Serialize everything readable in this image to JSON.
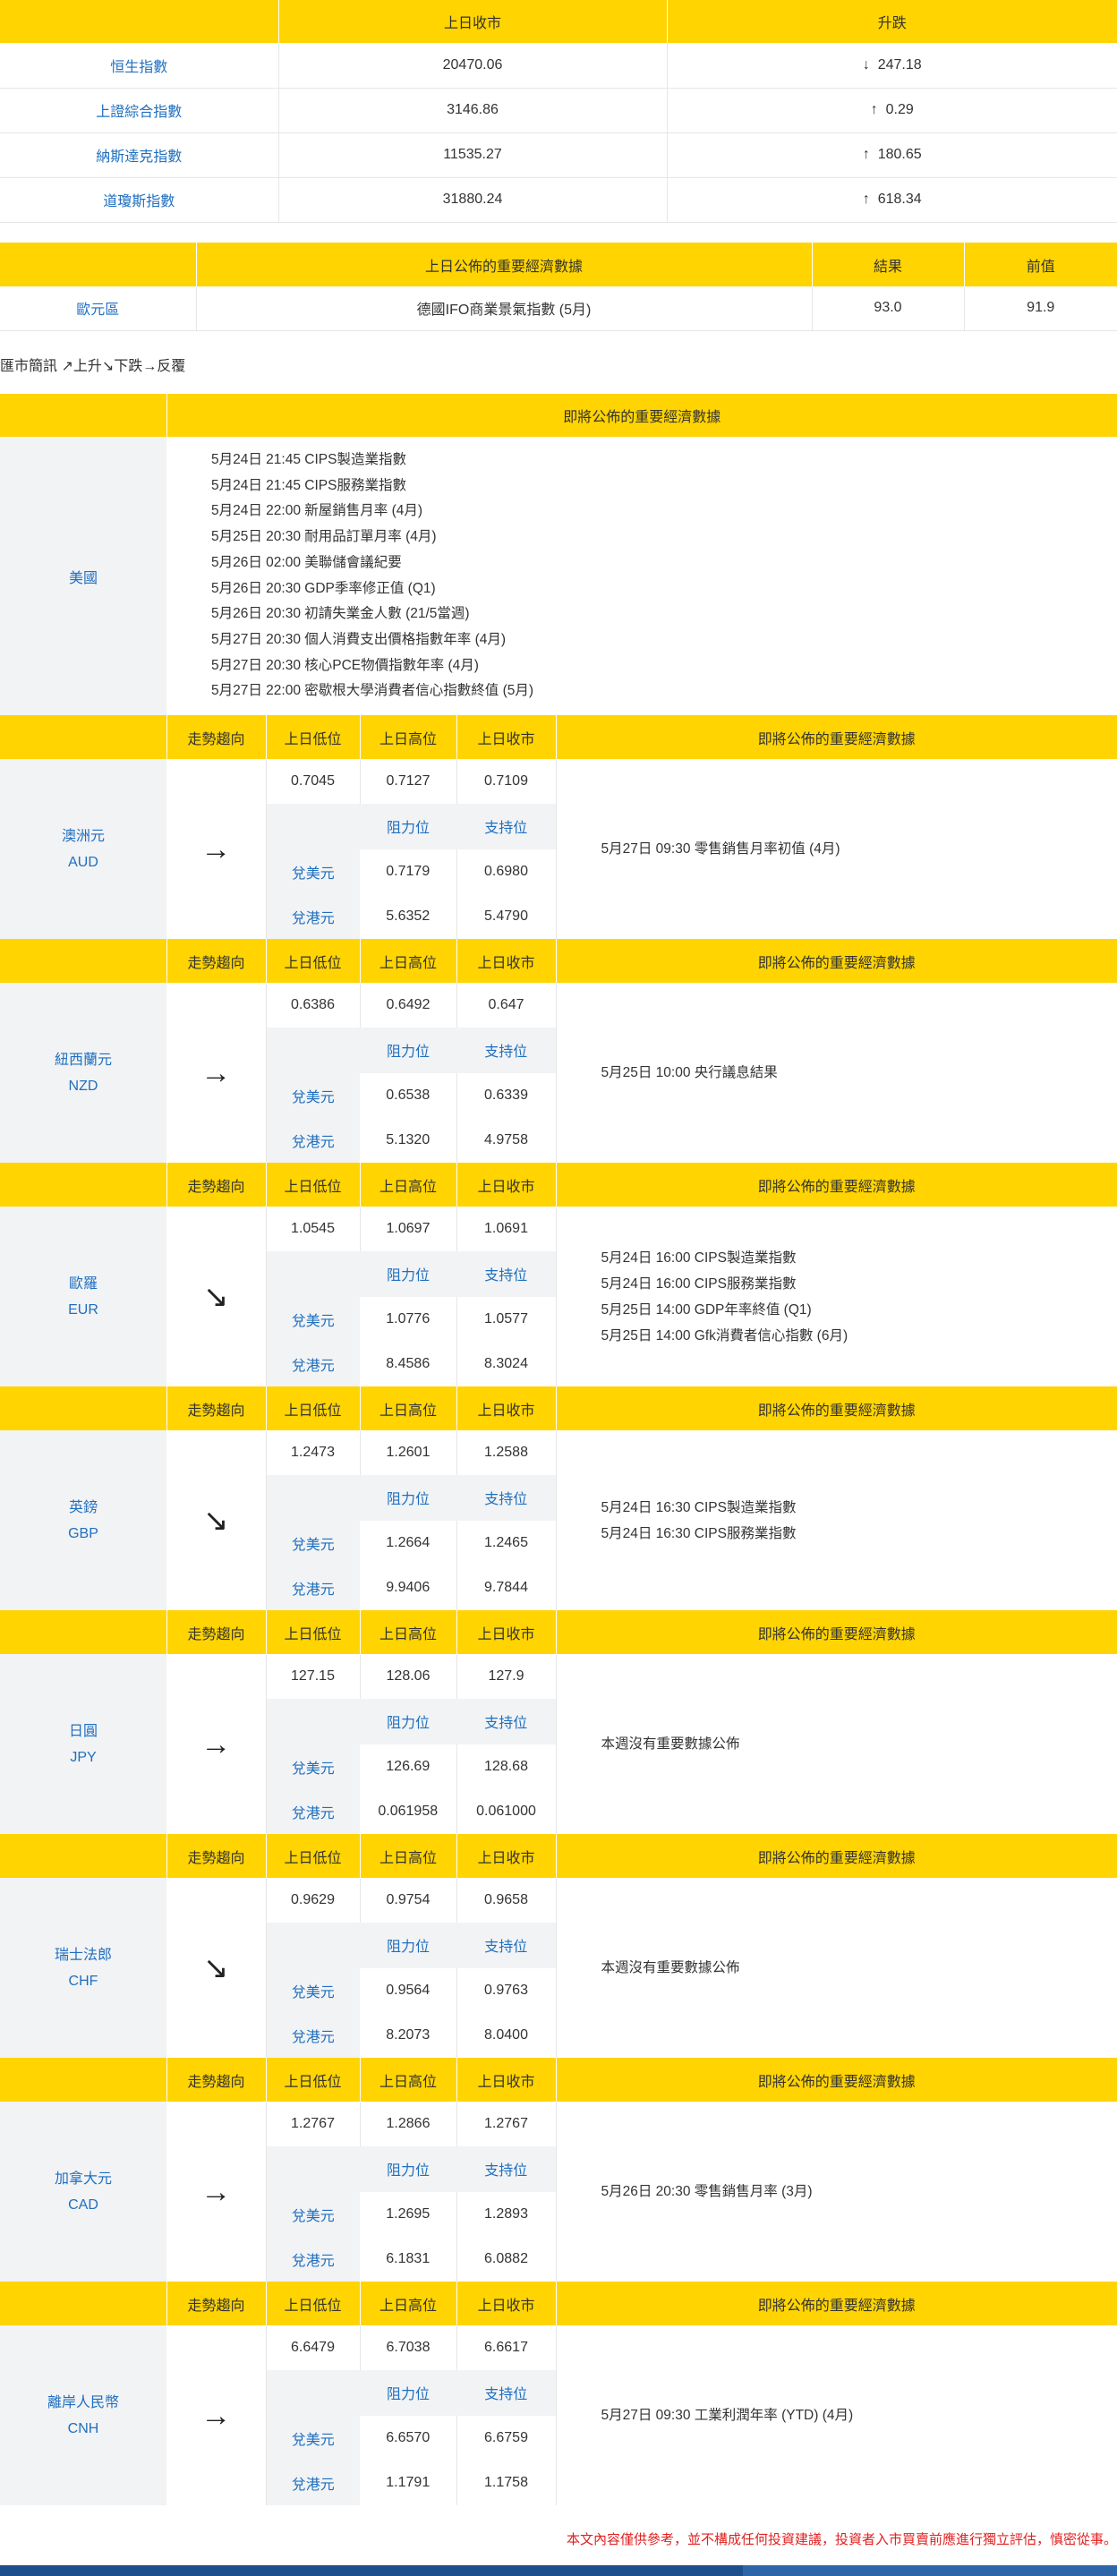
{
  "index_table": {
    "headers": [
      "",
      "上日收市",
      "升跌"
    ],
    "rows": [
      {
        "name": "恒生指數",
        "close": "20470.06",
        "dir": "↓",
        "change": "247.18"
      },
      {
        "name": "上證綜合指數",
        "close": "3146.86",
        "dir": "↑",
        "change": "0.29"
      },
      {
        "name": "納斯達克指數",
        "close": "11535.27",
        "dir": "↑",
        "change": "180.65"
      },
      {
        "name": "道瓊斯指數",
        "close": "31880.24",
        "dir": "↑",
        "change": "618.34"
      }
    ]
  },
  "econ_table": {
    "headers": [
      "",
      "上日公佈的重要經濟數據",
      "結果",
      "前值"
    ],
    "rows": [
      {
        "region": "歐元區",
        "item": "德國IFO商業景氣指數 (5月)",
        "result": "93.0",
        "previous": "91.9"
      }
    ]
  },
  "legend_text": "匯市簡訊 ↗上升↘下跌→反覆",
  "us_table": {
    "header": "即將公佈的重要經濟數據",
    "region": "美國",
    "events": [
      "5月24日 21:45 CIPS製造業指數",
      "5月24日 21:45 CIPS服務業指數",
      "5月24日 22:00 新屋銷售月率 (4月)",
      "5月25日 20:30 耐用品訂單月率 (4月)",
      "5月26日 02:00 美聯儲會議紀要",
      "5月26日 20:30 GDP季率修正值 (Q1)",
      "5月26日 20:30 初請失業金人數 (21/5當週)",
      "5月27日 20:30 個人消費支出價格指數年率 (4月)",
      "5月27日 20:30 核心PCE物價指數年率 (4月)",
      "5月27日 22:00 密歇根大學消費者信心指數終值 (5月)"
    ]
  },
  "fx_headers": {
    "trend": "走勢趨向",
    "low": "上日低位",
    "high": "上日高位",
    "close": "上日收市",
    "events": "即將公佈的重要經濟數據",
    "resistance": "阻力位",
    "support": "支持位",
    "vs_usd": "兌美元",
    "vs_hkd": "兌港元"
  },
  "currencies": [
    {
      "name": "澳洲元",
      "code": "AUD",
      "trend": "→",
      "low": "0.7045",
      "high": "0.7127",
      "close": "0.7109",
      "usd_res": "0.7179",
      "usd_sup": "0.6980",
      "hkd_res": "5.6352",
      "hkd_sup": "5.4790",
      "events": [
        "5月27日 09:30 零售銷售月率初值 (4月)"
      ]
    },
    {
      "name": "紐西蘭元",
      "code": "NZD",
      "trend": "→",
      "low": "0.6386",
      "high": "0.6492",
      "close": "0.647",
      "usd_res": "0.6538",
      "usd_sup": "0.6339",
      "hkd_res": "5.1320",
      "hkd_sup": "4.9758",
      "events": [
        "5月25日 10:00 央行議息結果"
      ]
    },
    {
      "name": "歐羅",
      "code": "EUR",
      "trend": "↘",
      "low": "1.0545",
      "high": "1.0697",
      "close": "1.0691",
      "usd_res": "1.0776",
      "usd_sup": "1.0577",
      "hkd_res": "8.4586",
      "hkd_sup": "8.3024",
      "events": [
        "5月24日 16:00 CIPS製造業指數",
        "5月24日 16:00 CIPS服務業指數",
        "5月25日 14:00 GDP年率終值 (Q1)",
        "5月25日 14:00 Gfk消費者信心指數 (6月)"
      ]
    },
    {
      "name": "英鎊",
      "code": "GBP",
      "trend": "↘",
      "low": "1.2473",
      "high": "1.2601",
      "close": "1.2588",
      "usd_res": "1.2664",
      "usd_sup": "1.2465",
      "hkd_res": "9.9406",
      "hkd_sup": "9.7844",
      "events": [
        "5月24日 16:30 CIPS製造業指數",
        "5月24日 16:30 CIPS服務業指數"
      ]
    },
    {
      "name": "日圓",
      "code": "JPY",
      "trend": "→",
      "low": "127.15",
      "high": "128.06",
      "close": "127.9",
      "usd_res": "126.69",
      "usd_sup": "128.68",
      "hkd_res": "0.061958",
      "hkd_sup": "0.061000",
      "events": [
        "本週沒有重要數據公佈"
      ]
    },
    {
      "name": "瑞士法郎",
      "code": "CHF",
      "trend": "↘",
      "low": "0.9629",
      "high": "0.9754",
      "close": "0.9658",
      "usd_res": "0.9564",
      "usd_sup": "0.9763",
      "hkd_res": "8.2073",
      "hkd_sup": "8.0400",
      "events": [
        "本週沒有重要數據公佈"
      ]
    },
    {
      "name": "加拿大元",
      "code": "CAD",
      "trend": "→",
      "low": "1.2767",
      "high": "1.2866",
      "close": "1.2767",
      "usd_res": "1.2695",
      "usd_sup": "1.2893",
      "hkd_res": "6.1831",
      "hkd_sup": "6.0882",
      "events": [
        "5月26日 20:30 零售銷售月率 (3月)"
      ]
    },
    {
      "name": "離岸人民幣",
      "code": "CNH",
      "trend": "→",
      "low": "6.6479",
      "high": "6.7038",
      "close": "6.6617",
      "usd_res": "6.6570",
      "usd_sup": "6.6759",
      "hkd_res": "1.1791",
      "hkd_sup": "1.1758",
      "events": [
        "5月27日 09:30 工業利潤年率 (YTD) (4月)"
      ]
    }
  ],
  "disclaimer": "本文內容僅供參考，並不構成任何投資建議，投資者入市買賣前應進行獨立評估，慎密從事。"
}
